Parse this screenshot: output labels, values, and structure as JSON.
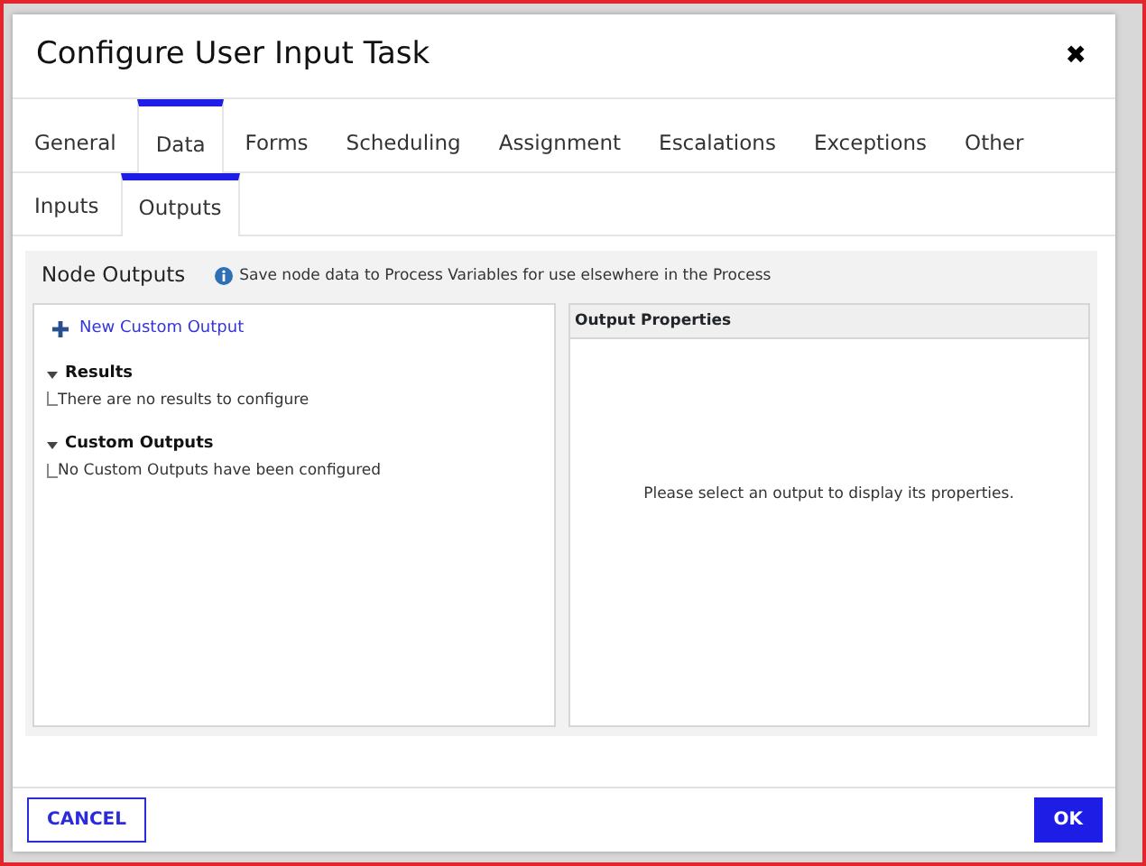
{
  "dialog": {
    "title": "Configure User Input Task",
    "close": "✖"
  },
  "tabs": [
    {
      "label": "General",
      "selected": false
    },
    {
      "label": "Data",
      "selected": true
    },
    {
      "label": "Forms",
      "selected": false
    },
    {
      "label": "Scheduling",
      "selected": false
    },
    {
      "label": "Assignment",
      "selected": false
    },
    {
      "label": "Escalations",
      "selected": false
    },
    {
      "label": "Exceptions",
      "selected": false
    },
    {
      "label": "Other",
      "selected": false
    }
  ],
  "subtabs": [
    {
      "label": "Inputs",
      "selected": false
    },
    {
      "label": "Outputs",
      "selected": true
    }
  ],
  "panel": {
    "title": "Node Outputs",
    "info": "Save node data to Process Variables for use elsewhere in the Process"
  },
  "outputs": {
    "new_button": "New Custom Output",
    "groups": [
      {
        "label": "Results",
        "expanded": true,
        "children": [
          {
            "label": "There are no results to configure"
          }
        ]
      },
      {
        "label": "Custom Outputs",
        "expanded": true,
        "children": [
          {
            "label": "No Custom Outputs have been configured"
          }
        ]
      }
    ]
  },
  "properties": {
    "title": "Output Properties",
    "message": "Please select an output to display its properties."
  },
  "buttons": [
    {
      "label": "CANCEL",
      "kind": "secondary"
    },
    {
      "label": "OK",
      "kind": "primary"
    }
  ]
}
